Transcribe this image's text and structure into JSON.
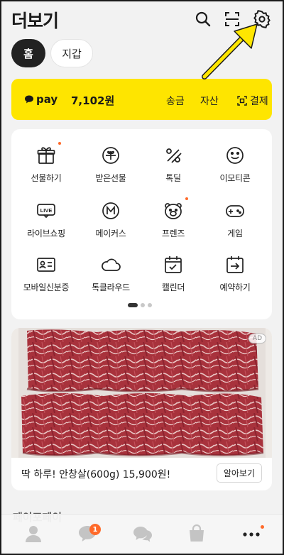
{
  "header": {
    "title": "더보기",
    "icons": [
      "search-icon",
      "scan-icon",
      "settings-icon"
    ]
  },
  "tabs": [
    {
      "label": "홈",
      "selected": true
    },
    {
      "label": "지갑",
      "selected": false
    }
  ],
  "pay": {
    "logo_label": "pay",
    "amount": "7,102원",
    "send_label": "송금",
    "asset_label": "자산",
    "payment_label": "결제",
    "accent_color": "#fee500"
  },
  "menu": {
    "items": [
      {
        "label": "선물하기",
        "icon": "gift-box-icon",
        "new": true
      },
      {
        "label": "받은선물",
        "icon": "gift-received-icon",
        "new": false
      },
      {
        "label": "톡딜",
        "icon": "discount-icon",
        "new": false
      },
      {
        "label": "이모티콘",
        "icon": "smile-icon",
        "new": false
      },
      {
        "label": "라이브쇼핑",
        "icon": "live-icon",
        "new": false
      },
      {
        "label": "메이커스",
        "icon": "makers-icon",
        "new": false
      },
      {
        "label": "프렌즈",
        "icon": "friends-bear-icon",
        "new": true
      },
      {
        "label": "게임",
        "icon": "gamepad-icon",
        "new": false
      },
      {
        "label": "모바일신분증",
        "icon": "id-card-icon",
        "new": false
      },
      {
        "label": "톡클라우드",
        "icon": "cloud-icon",
        "new": false
      },
      {
        "label": "캘린더",
        "icon": "calendar-icon",
        "new": false
      },
      {
        "label": "예약하기",
        "icon": "reservation-icon",
        "new": false
      }
    ],
    "page_index": 1,
    "page_count": 3
  },
  "ad": {
    "badge": "AD",
    "text": "딱 하루! 안창살(600g) 15,900원!",
    "button_label": "알아보기",
    "image": "beef-photo"
  },
  "section_peek": "페이포페이",
  "bottom_nav": {
    "items": [
      "friends-icon",
      "chats-icon",
      "openchat-icon",
      "shopping-icon",
      "more-icon"
    ],
    "chat_badge": "1"
  },
  "annotation": {
    "type": "arrow",
    "color": "#ffe600",
    "points_to": "settings-icon"
  }
}
